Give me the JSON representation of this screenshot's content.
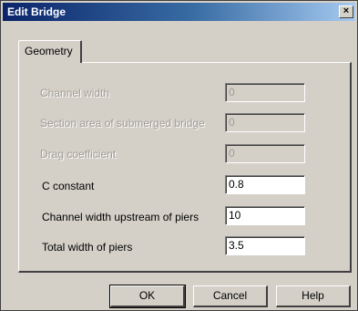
{
  "window": {
    "title": "Edit Bridge",
    "close_glyph": "×"
  },
  "tabs": [
    {
      "label": "Geometry",
      "selected": true
    }
  ],
  "fields": [
    {
      "label": "Channel width",
      "value": "0",
      "enabled": false
    },
    {
      "label": "Section area of submerged bridge",
      "value": "0",
      "enabled": false
    },
    {
      "label": "Drag coefficient",
      "value": "0",
      "enabled": false
    },
    {
      "label": "C constant",
      "value": "0.8",
      "enabled": true
    },
    {
      "label": "Channel width upstream of piers",
      "value": "10",
      "enabled": true
    },
    {
      "label": "Total width of piers",
      "value": "3.5",
      "enabled": true
    }
  ],
  "buttons": {
    "ok": "OK",
    "cancel": "Cancel",
    "help": "Help"
  },
  "colors": {
    "face": "#d4d0c8",
    "title_start": "#0a246a",
    "title_end": "#a6caf0",
    "disabled_text": "#a09c94"
  },
  "icons": {
    "close": "close-icon"
  }
}
